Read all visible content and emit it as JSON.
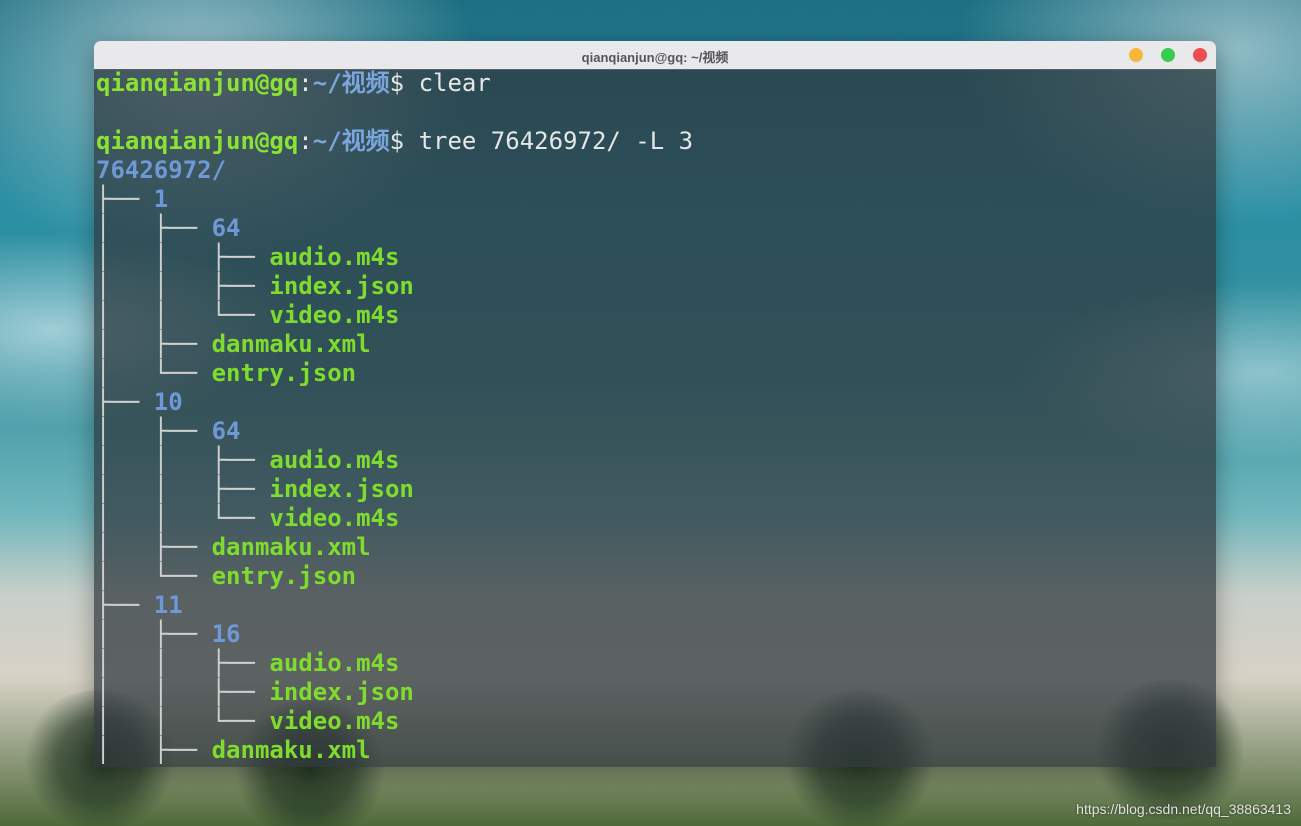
{
  "window": {
    "title": "qianqianjun@gq: ~/视频"
  },
  "prompt": {
    "user_host": "qianqianjun@gq",
    "separator": ":",
    "cwd": "~/视频",
    "symbol": "$"
  },
  "commands": {
    "first": "clear",
    "second": "tree 76426972/ -L 3"
  },
  "tree": {
    "root": "76426972/",
    "lines": [
      {
        "prefix": "├── ",
        "name": "1",
        "kind": "dir"
      },
      {
        "prefix": "│   ├── ",
        "name": "64",
        "kind": "dir"
      },
      {
        "prefix": "│   │   ├── ",
        "name": "audio.m4s",
        "kind": "file"
      },
      {
        "prefix": "│   │   ├── ",
        "name": "index.json",
        "kind": "file"
      },
      {
        "prefix": "│   │   └── ",
        "name": "video.m4s",
        "kind": "file"
      },
      {
        "prefix": "│   ├── ",
        "name": "danmaku.xml",
        "kind": "file"
      },
      {
        "prefix": "│   └── ",
        "name": "entry.json",
        "kind": "file"
      },
      {
        "prefix": "├── ",
        "name": "10",
        "kind": "dir"
      },
      {
        "prefix": "│   ├── ",
        "name": "64",
        "kind": "dir"
      },
      {
        "prefix": "│   │   ├── ",
        "name": "audio.m4s",
        "kind": "file"
      },
      {
        "prefix": "│   │   ├── ",
        "name": "index.json",
        "kind": "file"
      },
      {
        "prefix": "│   │   └── ",
        "name": "video.m4s",
        "kind": "file"
      },
      {
        "prefix": "│   ├── ",
        "name": "danmaku.xml",
        "kind": "file"
      },
      {
        "prefix": "│   └── ",
        "name": "entry.json",
        "kind": "file"
      },
      {
        "prefix": "├── ",
        "name": "11",
        "kind": "dir"
      },
      {
        "prefix": "│   ├── ",
        "name": "16",
        "kind": "dir"
      },
      {
        "prefix": "│   │   ├── ",
        "name": "audio.m4s",
        "kind": "file"
      },
      {
        "prefix": "│   │   ├── ",
        "name": "index.json",
        "kind": "file"
      },
      {
        "prefix": "│   │   └── ",
        "name": "video.m4s",
        "kind": "file"
      },
      {
        "prefix": "│   ├── ",
        "name": "danmaku.xml",
        "kind": "file"
      }
    ]
  },
  "watermark": "https://blog.csdn.net/qq_38863413",
  "colors": {
    "prompt_user": "#8ae234",
    "prompt_path": "#7aa5dd",
    "directory": "#6f98d6",
    "file": "#7fdc2e",
    "close_button": "#ec4f52",
    "minimize_button": "#f6b73a",
    "maximize_button": "#37cc4d"
  }
}
